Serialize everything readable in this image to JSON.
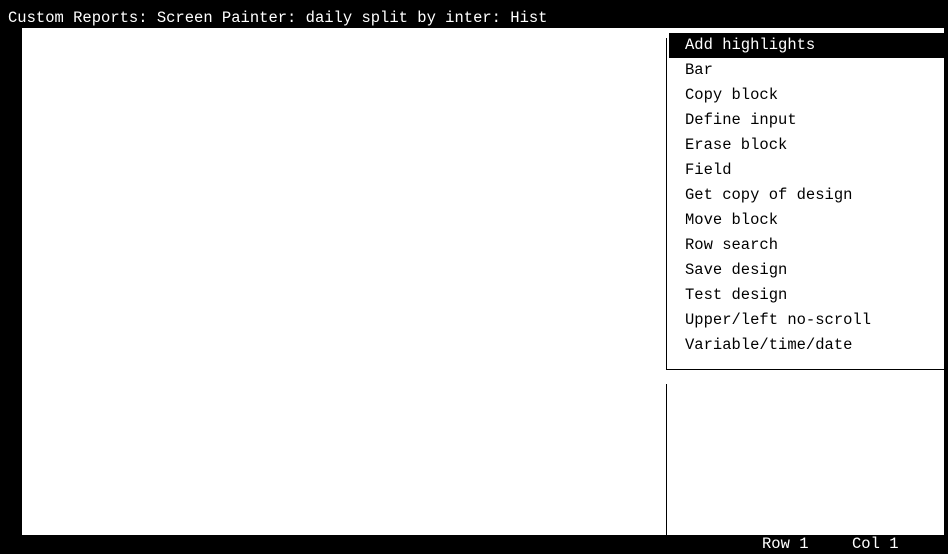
{
  "window": {
    "title": "Custom Reports: Screen Painter: daily split by inter: Hist"
  },
  "menu": {
    "items": [
      {
        "label": "Add highlights",
        "selected": true
      },
      {
        "label": "Bar",
        "selected": false
      },
      {
        "label": "Copy block",
        "selected": false
      },
      {
        "label": "Define input",
        "selected": false
      },
      {
        "label": "Erase block",
        "selected": false
      },
      {
        "label": "Field",
        "selected": false
      },
      {
        "label": "Get copy of design",
        "selected": false
      },
      {
        "label": "Move block",
        "selected": false
      },
      {
        "label": "Row search",
        "selected": false
      },
      {
        "label": "Save design",
        "selected": false
      },
      {
        "label": "Test design",
        "selected": false
      },
      {
        "label": "Upper/left no-scroll",
        "selected": false
      },
      {
        "label": "Variable/time/date",
        "selected": false
      }
    ]
  },
  "status": {
    "row": "Row 1",
    "col": "Col 1"
  },
  "colors": {
    "background": "#000000",
    "screen": "#ffffff",
    "highlight_bg": "#000000",
    "highlight_fg": "#ffffff"
  }
}
